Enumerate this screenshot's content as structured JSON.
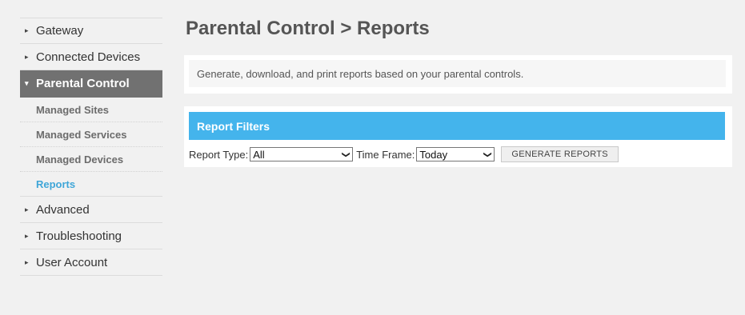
{
  "sidebar": {
    "items": [
      {
        "label": "Gateway"
      },
      {
        "label": "Connected Devices"
      },
      {
        "label": "Parental Control"
      },
      {
        "label": "Advanced"
      },
      {
        "label": "Troubleshooting"
      },
      {
        "label": "User Account"
      }
    ],
    "parental_sub": [
      {
        "label": "Managed Sites"
      },
      {
        "label": "Managed Services"
      },
      {
        "label": "Managed Devices"
      },
      {
        "label": "Reports"
      }
    ]
  },
  "page": {
    "title": "Parental Control > Reports",
    "description": "Generate, download, and print reports based on your parental controls."
  },
  "filters": {
    "header": "Report Filters",
    "report_type_label": "Report Type:",
    "report_type_value": "All",
    "time_frame_label": "Time Frame:",
    "time_frame_value": "Today",
    "generate_label": "GENERATE REPORTS"
  },
  "colors": {
    "accent": "#44b4ec",
    "active_nav": "#717171",
    "current_link": "#3fa6d8"
  },
  "icons": {
    "collapsed": "triangle-right-icon",
    "expanded": "triangle-down-icon",
    "select": "chevron-down-icon"
  }
}
